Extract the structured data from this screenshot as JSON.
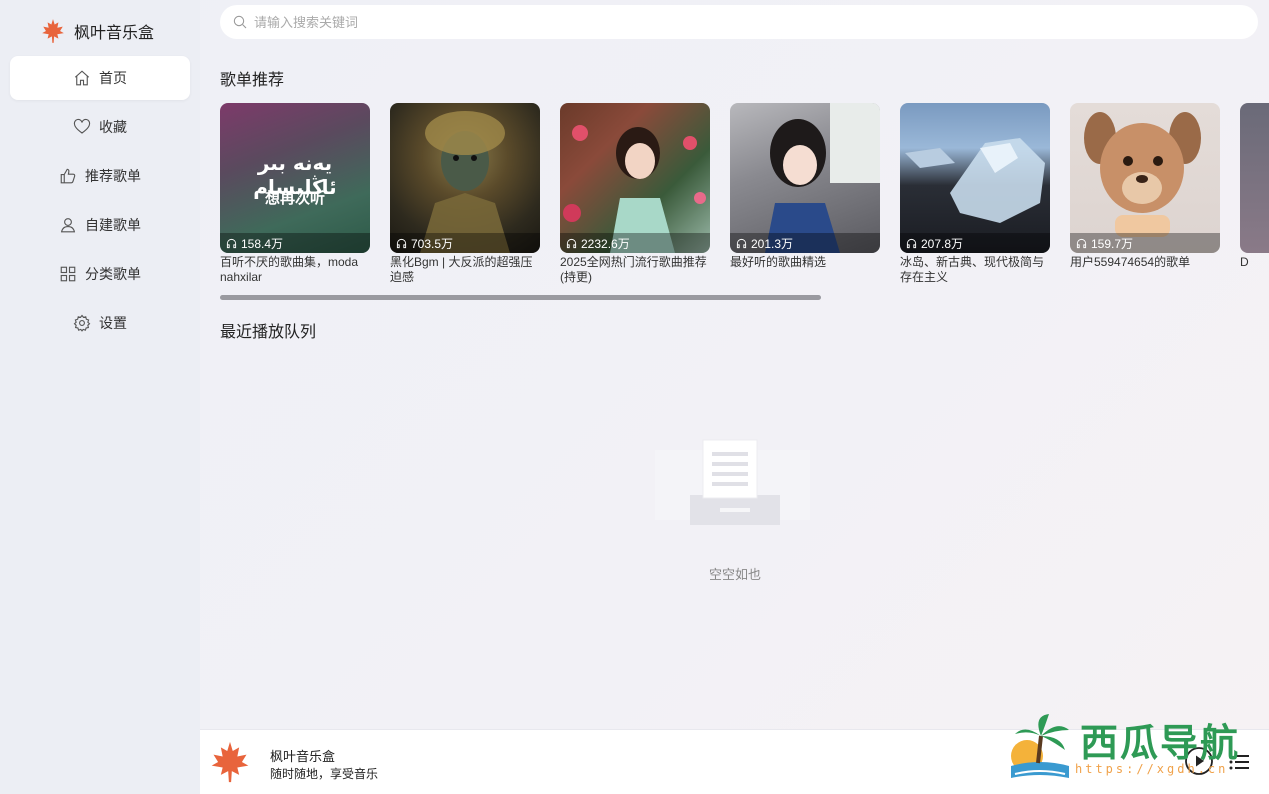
{
  "app": {
    "title": "枫叶音乐盒"
  },
  "search": {
    "placeholder": "请输入搜索关键词",
    "value": ""
  },
  "sidebar": {
    "items": [
      {
        "label": "首页",
        "icon": "home-icon",
        "active": true
      },
      {
        "label": "收藏",
        "icon": "heart-icon"
      },
      {
        "label": "推荐歌单",
        "icon": "thumbs-up-icon"
      },
      {
        "label": "自建歌单",
        "icon": "user-icon"
      },
      {
        "label": "分类歌单",
        "icon": "grid-icon"
      },
      {
        "label": "设置",
        "icon": "gear-icon"
      }
    ]
  },
  "sections": {
    "recommended": "歌单推荐",
    "recent_queue": "最近播放队列"
  },
  "playlists": [
    {
      "name": "百听不厌的歌曲集，moda nahxilar",
      "plays": "158.4万",
      "cover_text_1": "يەنە بىر ئاڭلىسام",
      "cover_text_2": "想再次听"
    },
    {
      "name": "黑化Bgm | 大反派的超强压迫感",
      "plays": "703.5万"
    },
    {
      "name": "2025全网热门流行歌曲推荐(持更)",
      "plays": "2232.6万"
    },
    {
      "name": "最好听的歌曲精选",
      "plays": "201.3万"
    },
    {
      "name": "冰岛、新古典、现代极简与存在主义",
      "plays": "207.8万"
    },
    {
      "name": "用户559474654的歌单",
      "plays": "159.7万"
    },
    {
      "name": "D",
      "plays": ""
    }
  ],
  "empty_state": {
    "text": "空空如也"
  },
  "player": {
    "song": "枫叶音乐盒",
    "artist": "随时随地，享受音乐"
  },
  "watermark": {
    "text": "西瓜导航",
    "url": "https://xgdh.cn"
  },
  "colors": {
    "accent": "#e8643c",
    "background": "#eef0f6",
    "watermark_green": "#2e9a55"
  }
}
